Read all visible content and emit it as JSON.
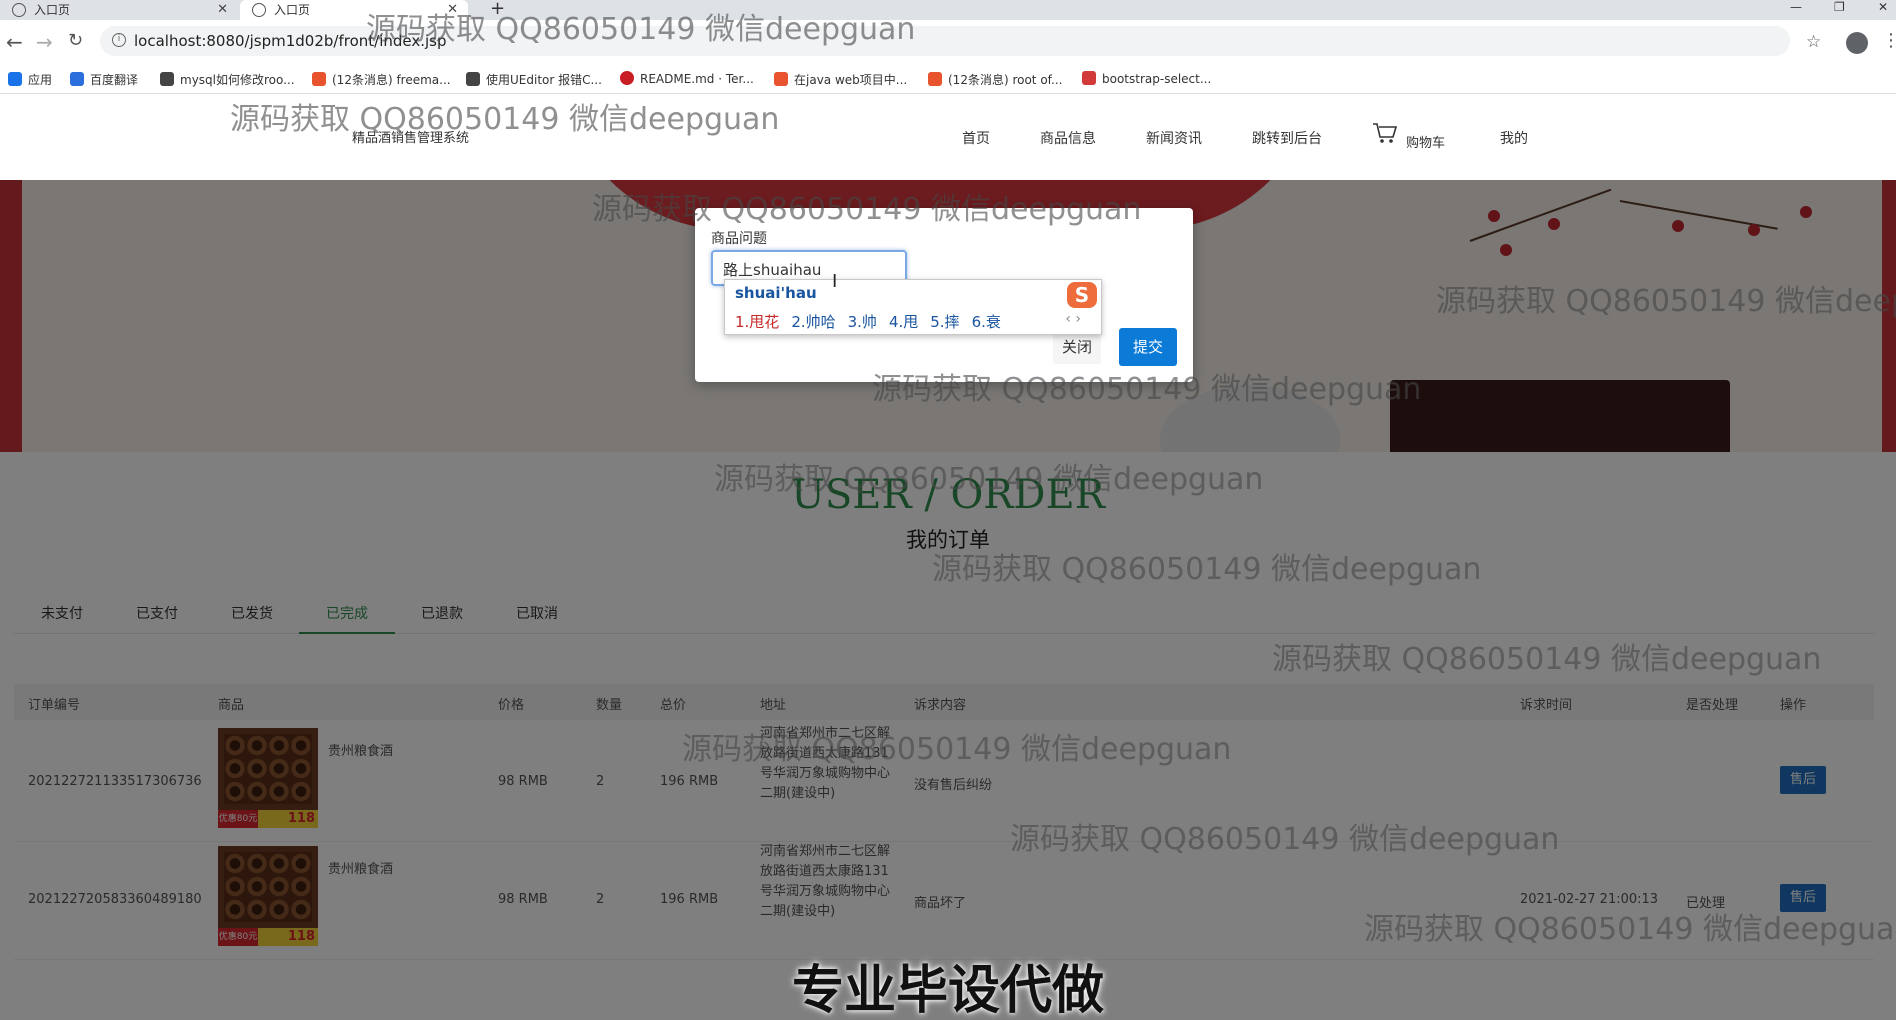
{
  "browser": {
    "tabs": [
      {
        "title": "入口页"
      },
      {
        "title": "入口页"
      }
    ],
    "url": "localhost:8080/jspm1d02b/front/index.jsp",
    "bookmarks": [
      {
        "label": "应用",
        "color": "#1a73e8"
      },
      {
        "label": "百度翻译",
        "color": "#2a6fdb"
      },
      {
        "label": "mysql如何修改roo...",
        "color": "#444444"
      },
      {
        "label": "(12条消息) freema...",
        "color": "#e8542e"
      },
      {
        "label": "使用UEditor 报错C...",
        "color": "#444444"
      },
      {
        "label": "README.md · Ter...",
        "color": "#c71d23"
      },
      {
        "label": "在java web项目中...",
        "color": "#e8542e"
      },
      {
        "label": "(12条消息) root of...",
        "color": "#e8542e"
      },
      {
        "label": "bootstrap-select...",
        "color": "#d23a3a"
      }
    ]
  },
  "site": {
    "brand": "精品酒销售管理系统",
    "nav": [
      "首页",
      "商品信息",
      "新闻资讯",
      "跳转到后台",
      "购物车",
      "我的"
    ]
  },
  "orders": {
    "title_en": "USER / ORDER",
    "title_cn": "我的订单",
    "tabs": [
      "未支付",
      "已支付",
      "已发货",
      "已完成",
      "已退款",
      "已取消"
    ],
    "active_tab": "已完成",
    "columns": [
      "订单编号",
      "商品",
      "价格",
      "数量",
      "总价",
      "地址",
      "诉求内容",
      "诉求时间",
      "是否处理",
      "操作"
    ],
    "rows": [
      {
        "order_no": "20212272113351730673​6",
        "product": "贵州粮食酒",
        "price": "98 RMB",
        "qty": "2",
        "total": "196 RMB",
        "address": "河南省郑州市二七区解放路街道西太康路131号华润万象城购物中心二期(建设中)",
        "complaint": "没有售后纠纷",
        "complaint_time": "",
        "handled": "",
        "action": "售后"
      },
      {
        "order_no": "20212272058336048918​0",
        "product": "贵州粮食酒",
        "price": "98 RMB",
        "qty": "2",
        "total": "196 RMB",
        "address": "河南省郑州市二七区解放路街道西太康路131号华润万象城购物中心二期(建设中)",
        "complaint": "商品坏了",
        "complaint_time": "2021-02-27 21:00:13",
        "handled": "已处理",
        "action": "售后"
      }
    ],
    "thumb_tag": "优惠80元",
    "thumb_price": "118"
  },
  "modal": {
    "label": "商品问题",
    "input_value": "路上shuaihau",
    "close_label": "关闭",
    "submit_label": "提交"
  },
  "ime": {
    "composition": "shuai'hau",
    "candidates": [
      "1.甩花",
      "2.帅哈",
      "3.帅",
      "4.甩",
      "5.摔",
      "6.衰"
    ],
    "logo": "S"
  },
  "watermark": "源码获取 QQ86050149 微信deepguan",
  "caption": "专业毕设代做"
}
